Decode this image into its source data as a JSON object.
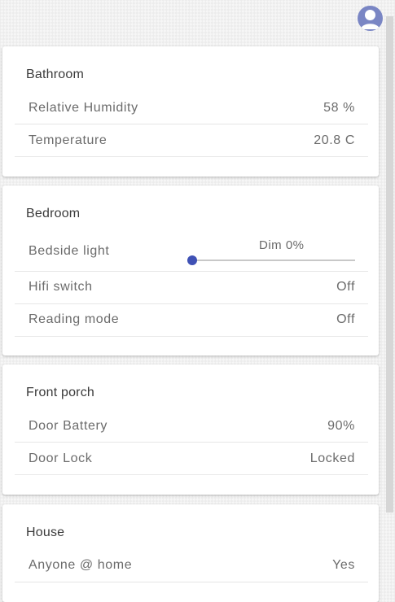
{
  "header": {
    "avatar_icon": "account-circle-icon",
    "avatar_color": "#7a86c4"
  },
  "cards": {
    "bathroom": {
      "title": "Bathroom",
      "rows": [
        {
          "label": "Relative Humidity",
          "value": "58 %"
        },
        {
          "label": "Temperature",
          "value": "20.8 C"
        }
      ]
    },
    "bedroom": {
      "title": "Bedroom",
      "light": {
        "label": "Bedside light",
        "caption": "Dim 0%",
        "level": 0
      },
      "rows": [
        {
          "label": "Hifi switch",
          "value": "Off"
        },
        {
          "label": "Reading mode",
          "value": "Off"
        }
      ]
    },
    "front_porch": {
      "title": "Front porch",
      "rows": [
        {
          "label": "Door Battery",
          "value": "90%"
        },
        {
          "label": "Door Lock",
          "value": "Locked"
        }
      ]
    },
    "house": {
      "title": "House",
      "rows": [
        {
          "label": "Anyone @ home",
          "value": "Yes"
        }
      ]
    }
  },
  "colors": {
    "accent": "#3f51b5"
  }
}
